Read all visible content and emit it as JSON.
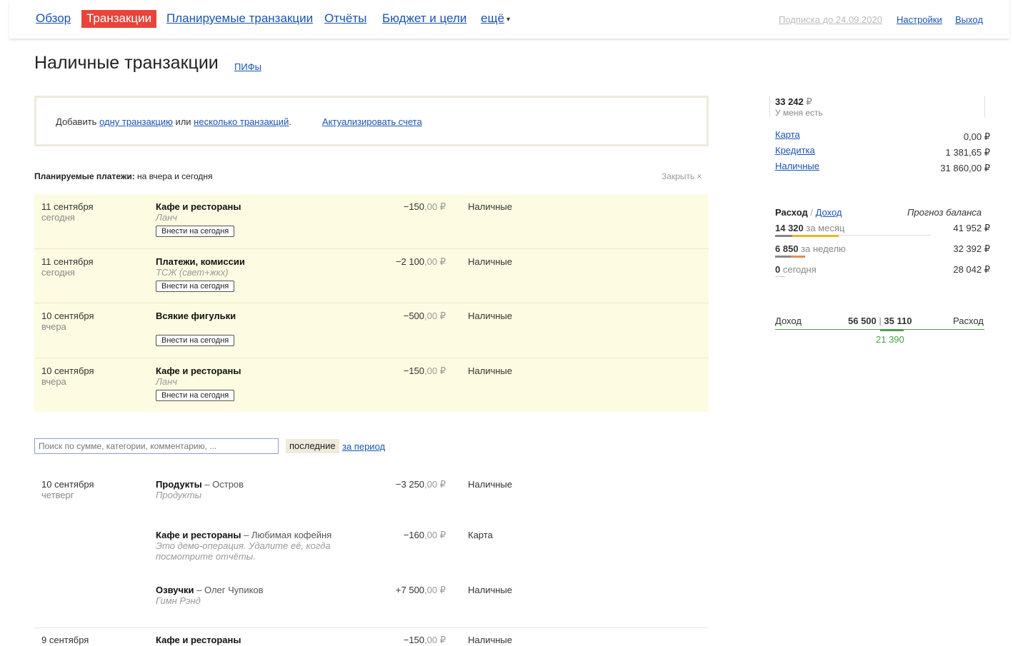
{
  "nav": {
    "items": [
      "Обзор",
      "Транзакции",
      "Планируемые транзакции",
      "Отчёты",
      "Бюджет и цели",
      "ещё"
    ],
    "more_arrow": "▾",
    "subscription": "Подписка до 24.09.2020",
    "settings": "Настройки",
    "logout": "Выход"
  },
  "page": {
    "title": "Наличные транзакции",
    "title_link": "ПИФы"
  },
  "addbox": {
    "prefix": "Добавить ",
    "link1": "одну транзакцию",
    "middle": " или ",
    "link2": "несколько транзакций",
    "suffix": ".",
    "update_link": "Актуализировать счета"
  },
  "planned": {
    "heading_bold": "Планируемые платежи:",
    "heading_rest": " на вчера и сегодня",
    "close": "Закрыть",
    "close_icon": "×",
    "button_label": "Внести на сегодня",
    "rows": [
      {
        "date": "11 сентября",
        "day": "сегодня",
        "category": "Кафе и рестораны",
        "note": "Ланч",
        "amount": "−150",
        "dec": ",00 ₽",
        "account": "Наличные"
      },
      {
        "date": "11 сентября",
        "day": "сегодня",
        "category": "Платежи, комиссии",
        "note": "ТСЖ (свет+жкх)",
        "amount": "−2 100",
        "dec": ",00 ₽",
        "account": "Наличные"
      },
      {
        "date": "10 сентября",
        "day": "вчера",
        "category": "Всякие фигульки",
        "note": "",
        "amount": "−500",
        "dec": ",00 ₽",
        "account": "Наличные"
      },
      {
        "date": "10 сентября",
        "day": "вчера",
        "category": "Кафе и рестораны",
        "note": "Ланч",
        "amount": "−150",
        "dec": ",00 ₽",
        "account": "Наличные"
      }
    ]
  },
  "search": {
    "placeholder": "Поиск по сумме, категории, комментарию, ..."
  },
  "filters": {
    "active": "последние",
    "link": "за период"
  },
  "transactions": [
    {
      "date": "10 сентября",
      "day": "четверг",
      "category": "Продукты",
      "payee": " – Остров",
      "note": "Продукты",
      "amount": "−3 250",
      "dec": ",00 ₽",
      "account": "Наличные"
    },
    {
      "date": "",
      "day": "",
      "category": "Кафе и рестораны",
      "payee": " – Любимая кофейня",
      "note": "Это демо-операция. Удалите её, когда посмотрите отчёты.",
      "amount": "−160",
      "dec": ",00 ₽",
      "account": "Карта"
    },
    {
      "date": "",
      "day": "",
      "category": "Озвучки",
      "payee": " – Олег Чупиков",
      "note": "Гимн Рэнд",
      "amount": "+7 500",
      "dec": ",00 ₽",
      "account": "Наличные"
    },
    {
      "date": "9 сентября",
      "day": "",
      "category": "Кафе и рестораны",
      "payee": "",
      "note": "",
      "amount": "−150",
      "dec": ",00 ₽",
      "account": "Наличные"
    }
  ],
  "sidebar": {
    "balance_main": "33 242",
    "balance_currency": " ₽",
    "balance_label": "У меня есть",
    "accounts": [
      {
        "name": "Карта",
        "value": "0,00 ₽"
      },
      {
        "name": "Кредитка",
        "value": "1 381,65 ₽"
      },
      {
        "name": "Наличные",
        "value": "31 860,00 ₽"
      }
    ],
    "expense_tab": "Расход",
    "tab_separator": "/",
    "income_tab": "Доход",
    "forecast_label": "Прогноз баланса",
    "expense_rows": [
      {
        "amount": "14 320",
        "label": " за месяц",
        "forecast": "41 952 ₽"
      },
      {
        "amount": "6 850",
        "label": " за неделю",
        "forecast": "32 392 ₽"
      },
      {
        "amount": "0",
        "label": " сегодня",
        "forecast": "28 042 ₽"
      }
    ],
    "income_label": "Доход",
    "income_value": "56 500",
    "ie_separator": "|",
    "expense_value": "35 110",
    "expense_label": "Расход",
    "difference": "21 390"
  },
  "colors": {
    "accent": "#e8443a",
    "link": "#1a55b0",
    "planned_bg": "#fdfbe1",
    "green": "#4aa14a",
    "bar_yellow": "#e5b82a",
    "bar_orange": "#e58a55"
  }
}
